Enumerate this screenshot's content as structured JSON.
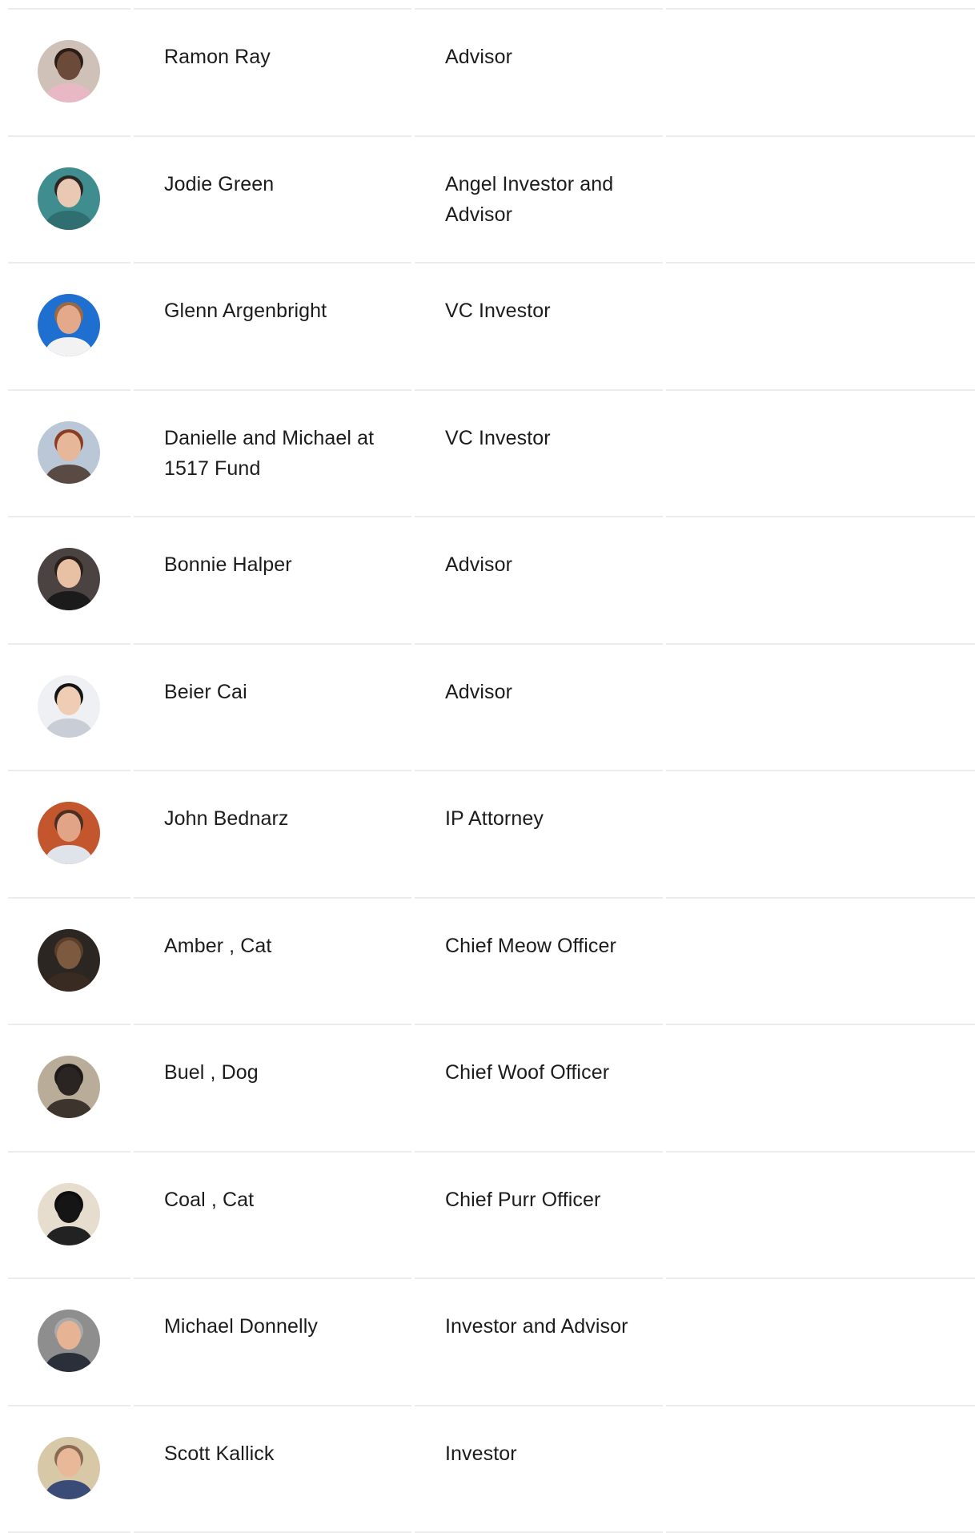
{
  "team": {
    "members": [
      {
        "name": "Ramon Ray",
        "role": "Advisor",
        "avatar_icon": "ramon-ray-photo",
        "bg": "#cfc0b8",
        "skin": "#6b4a3a",
        "shirt": "#e8b9c4",
        "hair": "#2a1d17"
      },
      {
        "name": "Jodie Green",
        "role": "Angel Investor and Advisor",
        "avatar_icon": "jodie-green-photo",
        "bg": "#3f8d8f",
        "skin": "#e9c9b3",
        "shirt": "#2f6f72",
        "hair": "#2d2521"
      },
      {
        "name": "Glenn Argenbright",
        "role": "VC Investor",
        "avatar_icon": "glenn-argenbright-photo",
        "bg": "#1f6fd0",
        "skin": "#e4a98b",
        "shirt": "#f2f2f2",
        "hair": "#9a6a45"
      },
      {
        "name": "Danielle and Michael at 1517 Fund",
        "role": "VC Investor",
        "avatar_icon": "danielle-michael-photo",
        "bg": "#b9c7d6",
        "skin": "#e7b79a",
        "shirt": "#5a4a44",
        "hair": "#8a3d22"
      },
      {
        "name": "Bonnie Halper",
        "role": "Advisor",
        "avatar_icon": "bonnie-halper-photo",
        "bg": "#4a4342",
        "skin": "#e8c1a5",
        "shirt": "#1b1b1b",
        "hair": "#2b1f1b"
      },
      {
        "name": "Beier Cai",
        "role": "Advisor",
        "avatar_icon": "beier-cai-photo",
        "bg": "#eef0f3",
        "skin": "#efcdb4",
        "shirt": "#c9ced6",
        "hair": "#151515"
      },
      {
        "name": "John Bednarz",
        "role": "IP Attorney",
        "avatar_icon": "john-bednarz-photo",
        "bg": "#c4562e",
        "skin": "#e2a486",
        "shirt": "#dfe3ea",
        "hair": "#4a2f22"
      },
      {
        "name": "Amber , Cat",
        "role": "Chief Meow Officer",
        "avatar_icon": "amber-cat-photo",
        "bg": "#2c2622",
        "skin": "#7b5a40",
        "shirt": "#3a2b22",
        "hair": "#5b3e2a"
      },
      {
        "name": "Buel , Dog",
        "role": "Chief Woof Officer",
        "avatar_icon": "buel-dog-photo",
        "bg": "#b9ad9a",
        "skin": "#2a2522",
        "shirt": "#3d342e",
        "hair": "#1e1a18"
      },
      {
        "name": "Coal , Cat",
        "role": "Chief Purr Officer",
        "avatar_icon": "coal-cat-photo",
        "bg": "#e6ddcf",
        "skin": "#151515",
        "shirt": "#222222",
        "hair": "#0e0e0e"
      },
      {
        "name": "Michael Donnelly",
        "role": "Investor and Advisor",
        "avatar_icon": "michael-donnelly-photo",
        "bg": "#8e8e8e",
        "skin": "#e6b394",
        "shirt": "#2a2f3a",
        "hair": "#a9a9a9"
      },
      {
        "name": "Scott Kallick",
        "role": "Investor",
        "avatar_icon": "scott-kallick-photo",
        "bg": "#d7c8a8",
        "skin": "#e9b899",
        "shirt": "#3a4b78",
        "hair": "#8a6a52"
      }
    ]
  }
}
